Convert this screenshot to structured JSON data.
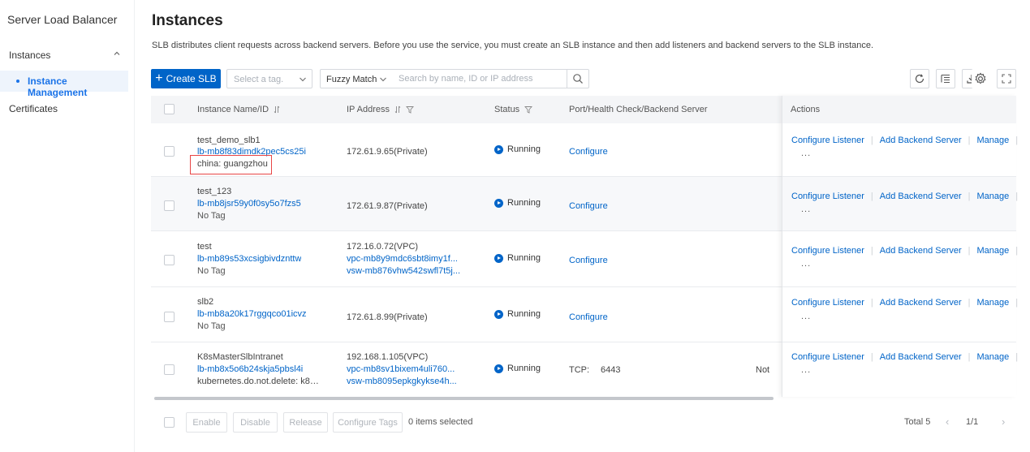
{
  "sidebar": {
    "title": "Server Load Balancer",
    "group_label": "Instances",
    "active_item": "Instance Management",
    "other_item": "Certificates"
  },
  "header": {
    "title": "Instances",
    "description": "SLB distributes client requests across backend servers. Before you use the service, you must create an SLB instance and then add listeners and backend servers to the SLB instance."
  },
  "toolbar": {
    "create_label": "Create SLB",
    "tag_placeholder": "Select a tag.",
    "match_value": "Fuzzy Match",
    "search_placeholder": "Search by name, ID or IP address",
    "icons": [
      "refresh-icon",
      "list-settings-icon",
      "download-icon",
      "gear-icon",
      "fullscreen-icon"
    ]
  },
  "table": {
    "columns": [
      "Instance Name/ID",
      "IP Address",
      "Status",
      "Port/Health Check/Backend Server",
      "Actions"
    ],
    "rows": [
      {
        "name": "test_demo_slb1",
        "id": "lb-mb8f83dimdk2pec5cs25i",
        "tag": "china: guangzhou",
        "ip1": "172.61.9.65(Private)",
        "ip2": "",
        "ip3": "",
        "status": "Running",
        "port": "Configure",
        "port_value": "",
        "port_extra": ""
      },
      {
        "name": "test_123",
        "id": "lb-mb8jsr59y0f0sy5o7fzs5",
        "tag": "No Tag",
        "ip1": "172.61.9.87(Private)",
        "ip2": "",
        "ip3": "",
        "status": "Running",
        "port": "Configure",
        "port_value": "",
        "port_extra": ""
      },
      {
        "name": "test",
        "id": "lb-mb89s53xcsigbivdznttw",
        "tag": "No Tag",
        "ip1": "172.16.0.72(VPC)",
        "ip2": "vpc-mb8y9mdc6sbt8imy1f...",
        "ip3": "vsw-mb876vhw542swfl7t5j...",
        "status": "Running",
        "port": "Configure",
        "port_value": "",
        "port_extra": ""
      },
      {
        "name": "slb2",
        "id": "lb-mb8a20k17rggqco01icvz",
        "tag": "No Tag",
        "ip1": "172.61.8.99(Private)",
        "ip2": "",
        "ip3": "",
        "status": "Running",
        "port": "Configure",
        "port_value": "",
        "port_extra": ""
      },
      {
        "name": "K8sMasterSlbIntranet",
        "id": "lb-mb8x5o6b24skja5pbsl4i",
        "tag": "kubernetes.do.not.delete: k8s-for-...",
        "ip1": "192.168.1.105(VPC)",
        "ip2": "vpc-mb8sv1bixem4uli760...",
        "ip3": "vsw-mb8095epkgkykse4h...",
        "status": "Running",
        "port": "TCP:",
        "port_value": "6443",
        "port_extra": "Not"
      }
    ],
    "actions": {
      "configure_listener": "Configure Listener",
      "add_backend": "Add Backend Server",
      "manage": "Manage",
      "more": "..."
    }
  },
  "footer": {
    "buttons": [
      "Enable",
      "Disable",
      "Release",
      "Configure Tags"
    ],
    "selected_text": "0 items selected",
    "total_text": "Total 5",
    "page_text": "1/1"
  },
  "colors": {
    "accent": "#0064c8",
    "highlight_border": "#e84545",
    "header_bg": "#f4f5f7"
  }
}
